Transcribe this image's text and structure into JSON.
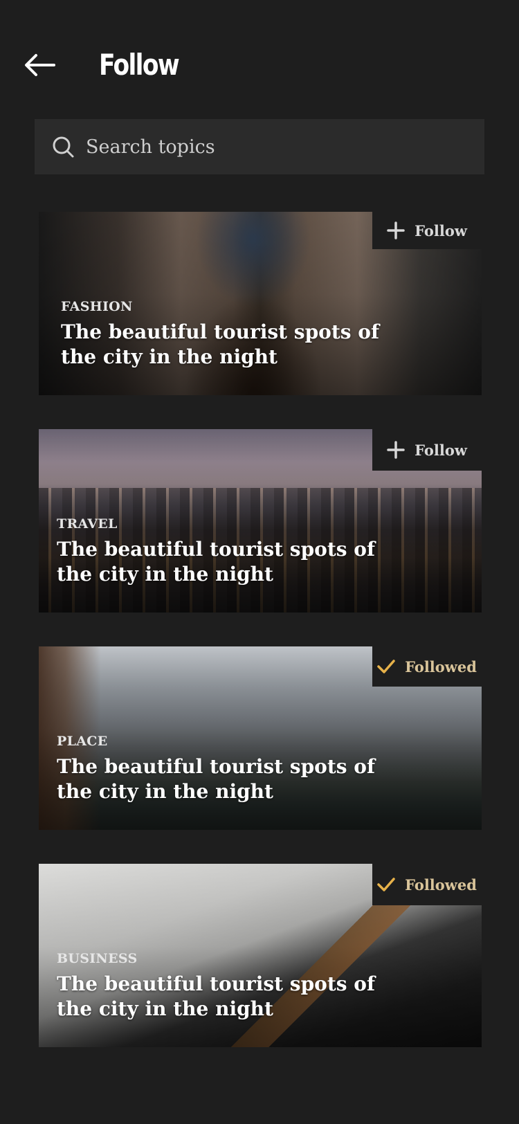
{
  "header": {
    "title": "Follow"
  },
  "search": {
    "placeholder": "Search topics"
  },
  "cards": [
    {
      "category": "FASHION",
      "headline": "The beautiful tourist spots of the city in the night",
      "button": "Follow",
      "followed": false
    },
    {
      "category": "TRAVEL",
      "headline": "The beautiful tourist spots of the city in the night",
      "button": "Follow",
      "followed": false
    },
    {
      "category": "PLACE",
      "headline": "The beautiful tourist spots of the city in the night",
      "button": "Followed",
      "followed": true
    },
    {
      "category": "BUSINESS",
      "headline": "The beautiful tourist spots of the city in the night",
      "button": "Followed",
      "followed": true
    }
  ],
  "colors": {
    "background": "#1e1e1e",
    "search_bg": "#2b2b2b",
    "followed_accent": "#e7b24a"
  },
  "icons": {
    "back": "arrow-left-icon",
    "search": "search-icon",
    "follow": "plus-icon",
    "followed": "check-icon"
  }
}
